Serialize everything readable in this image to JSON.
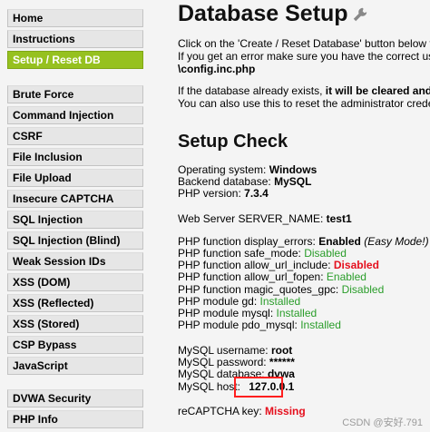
{
  "sidebar": {
    "groups": [
      [
        "Home",
        "Instructions",
        "Setup / Reset DB"
      ],
      [
        "Brute Force",
        "Command Injection",
        "CSRF",
        "File Inclusion",
        "File Upload",
        "Insecure CAPTCHA",
        "SQL Injection",
        "SQL Injection (Blind)",
        "Weak Session IDs",
        "XSS (DOM)",
        "XSS (Reflected)",
        "XSS (Stored)",
        "CSP Bypass",
        "JavaScript"
      ],
      [
        "DVWA Security",
        "PHP Info"
      ]
    ],
    "active": "Setup / Reset DB"
  },
  "main": {
    "title": "Database Setup",
    "title_icon": "wrench-icon",
    "intro_1": "Click on the 'Create / Reset Database' button below to",
    "intro_2": "If you get an error make sure you have the correct use",
    "intro_3": "\\config.inc.php",
    "warn_1a": "If the database already exists, ",
    "warn_1b": "it will be cleared and th",
    "warn_2": "You can also use this to reset the administrator creden",
    "setup_check": "Setup Check",
    "os_label": "Operating system: ",
    "os_value": "Windows",
    "db_label": "Backend database: ",
    "db_value": "MySQL",
    "php_label": "PHP version: ",
    "php_value": "7.3.4",
    "server_label": "Web Server SERVER_NAME: ",
    "server_value": "test1",
    "display_errors_label": "PHP function display_errors: ",
    "display_errors_value": "Enabled",
    "display_errors_note": " (Easy Mode!)",
    "safe_mode_label": "PHP function safe_mode: ",
    "safe_mode_value": "Disabled",
    "allow_url_include_label": "PHP function allow_url_include: ",
    "allow_url_include_value": "Disabled",
    "allow_url_fopen_label": "PHP function allow_url_fopen: ",
    "allow_url_fopen_value": "Enabled",
    "magic_quotes_label": "PHP function magic_quotes_gpc: ",
    "magic_quotes_value": "Disabled",
    "gd_label": "PHP module gd: ",
    "gd_value": "Installed",
    "mysql_mod_label": "PHP module mysql: ",
    "mysql_mod_value": "Installed",
    "pdo_label": "PHP module pdo_mysql: ",
    "pdo_value": "Installed",
    "mysql_user_label": "MySQL username: ",
    "mysql_user_value": "root",
    "mysql_pass_label": "MySQL password: ",
    "mysql_pass_value": "******",
    "mysql_db_label": "MySQL database: ",
    "mysql_db_value": "dvwa",
    "mysql_host_label": "MySQL host: ",
    "mysql_host_value": "127.0.0.1",
    "recaptcha_label": "reCAPTCHA key: ",
    "recaptcha_value": "Missing"
  },
  "watermark": "CSDN @安好.791",
  "colors": {
    "active_nav": "#96c11f",
    "ok": "#2a9d2a",
    "bad": "#e5101e",
    "highlight": "#ff1f1f"
  }
}
